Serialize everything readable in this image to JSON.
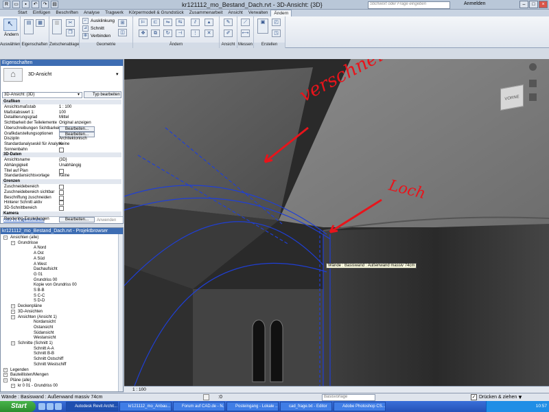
{
  "title_bar": {
    "title": "kr121112_mo_Bestand_Dach.rvt - 3D-Ansicht: {3D}",
    "search_placeholder": "Stichwort oder Frage eingeben",
    "login": "Anmelden"
  },
  "ribbon_tabs": [
    "Start",
    "Einfügen",
    "Beschriften",
    "Analyse",
    "Tragwerk",
    "Körpermodell & Grundstück",
    "Zusammenarbeit",
    "Ansicht",
    "Verwalten",
    "Ändern"
  ],
  "ribbon": {
    "modify_label": "Ändern",
    "trim_label": "Ausklinkung",
    "cut_label": "Schnitt",
    "join_label": "Verbinden",
    "groups": [
      "Auswählen",
      "Eigenschaften",
      "Zwischenablage",
      "Geometrie",
      "Ändern",
      "Ansicht",
      "Messen",
      "Erstellen"
    ]
  },
  "properties": {
    "header": "Eigenschaften",
    "type_name": "3D-Ansicht",
    "selector": "3D-Ansicht: {3D}",
    "edit_type": "Typ bearbeiten",
    "sections": {
      "graphics": "Grafiken",
      "data3d": "3D-Daten",
      "limits": "Grenzen",
      "camera": "Kamera"
    },
    "rows": [
      {
        "k": "Ansichtsmaßstab",
        "v": "1 : 100"
      },
      {
        "k": "Maßstabswert 1:",
        "v": "100"
      },
      {
        "k": "Detaillierungsgrad",
        "v": "Mittel"
      },
      {
        "k": "Sichtbarkeit der Teilelemente",
        "v": "Original anzeigen"
      },
      {
        "k": "Überschreibungen Sichtbarkeit...",
        "v": "Bearbeiten..."
      },
      {
        "k": "Grafikdarstellungsoptionen",
        "v": "Bearbeiten..."
      },
      {
        "k": "Disziplin",
        "v": "Architektonisch"
      },
      {
        "k": "Standardanalyseskil für Analyse",
        "v": "Keine"
      },
      {
        "k": "Sonnenbahn",
        "v": ""
      },
      {
        "k": "Ansichtsname",
        "v": "{3D}"
      },
      {
        "k": "Abhängigkeit",
        "v": "Unabhängig"
      },
      {
        "k": "Titel auf Plan",
        "v": ""
      },
      {
        "k": "Standardansichtsvorlage",
        "v": "Keine"
      },
      {
        "k": "Zuschneidebereich",
        "v": ""
      },
      {
        "k": "Zuschneidebereich sichtbar",
        "v": ""
      },
      {
        "k": "Beschriftung zuschneiden",
        "v": ""
      },
      {
        "k": "Hinterer Schnitt aktiv",
        "v": ""
      },
      {
        "k": "3D-Schnittbereich",
        "v": ""
      },
      {
        "k": "Rendering-Einstellungen",
        "v": "Bearbeiten..."
      }
    ],
    "help_link": "Hilfe zu Eigenschaften",
    "apply": "Anwenden"
  },
  "browser": {
    "header": "kr121112_mo_Bestand_Dach.rvt - Projektbrowser",
    "items": [
      {
        "label": "Ansichten (alle)",
        "depth": 0
      },
      {
        "label": "Grundrisse",
        "depth": 1
      },
      {
        "label": "A Nord",
        "depth": 2
      },
      {
        "label": "A Ost",
        "depth": 2
      },
      {
        "label": "A Süd",
        "depth": 2
      },
      {
        "label": "A West",
        "depth": 2
      },
      {
        "label": "Dachaufsicht",
        "depth": 2
      },
      {
        "label": "G 01",
        "depth": 2
      },
      {
        "label": "Grundriss 00",
        "depth": 2
      },
      {
        "label": "Kopie von Grundriss 00",
        "depth": 2
      },
      {
        "label": "S B-B",
        "depth": 2
      },
      {
        "label": "S C-C",
        "depth": 2
      },
      {
        "label": "S D-D",
        "depth": 2
      },
      {
        "label": "Deckenpläne",
        "depth": 1
      },
      {
        "label": "3D-Ansichten",
        "depth": 1
      },
      {
        "label": "Ansichten (Ansicht 1)",
        "depth": 1
      },
      {
        "label": "Nordansicht",
        "depth": 2
      },
      {
        "label": "Ostansicht",
        "depth": 2
      },
      {
        "label": "Südansicht",
        "depth": 2
      },
      {
        "label": "Westansicht",
        "depth": 2
      },
      {
        "label": "Schnitte (Schnitt 1)",
        "depth": 1
      },
      {
        "label": "Schnitt A-A",
        "depth": 2
      },
      {
        "label": "Schnitt B-B",
        "depth": 2
      },
      {
        "label": "Schnitt Ostschiff",
        "depth": 2
      },
      {
        "label": "Schnitt Westschiff",
        "depth": 2
      },
      {
        "label": "Legenden",
        "depth": 0
      },
      {
        "label": "Bauteillisten/Mengen",
        "depth": 0
      },
      {
        "label": "Pläne (alle)",
        "depth": 0
      },
      {
        "label": "kr 0 01 - Grundriss 00",
        "depth": 1
      }
    ]
  },
  "viewport": {
    "annotation_cut": "verschneiden",
    "annotation_hole": "Loch",
    "tooltip": "Wände : Basiswand : Außenwand massiv 74cm",
    "viewcube": "VORNE",
    "scale": "1 : 100",
    "colors": {
      "annotation": "#e8141b",
      "edges": "#1f3fd6"
    }
  },
  "status": {
    "text": "Wände : Basiswand : Außenwand massiv 74cm",
    "count": ":0",
    "model": "Basisvorlage",
    "drag": "Drücken & ziehen"
  },
  "taskbar": {
    "start": "Start",
    "items": [
      "Autodesk Revit Archit...",
      "kr121112_mo_Anbau...",
      "Forum auf CAD.de - N...",
      "Posteingang - Lokale ...",
      "cad_frage.txt - Editor",
      "Adobe Photoshop CS..."
    ],
    "clock": "10:57"
  }
}
